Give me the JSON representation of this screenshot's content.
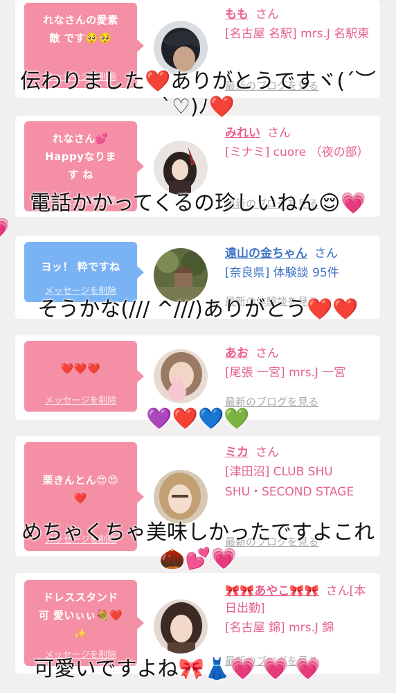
{
  "cards": [
    {
      "message": "れなさんの愛素敵 です🥺🥺",
      "delete_label": "メッセージを削除",
      "user": "もも",
      "san": "さん",
      "shop": "[名古屋 名駅] mrs.J 名駅東",
      "blog": "最新のブログを見る"
    },
    {
      "message": "れなさん💕 Happyなります ね",
      "delete_label": "メッセージを削除",
      "user": "みれい",
      "san": "さん",
      "shop": "[ミナミ] cuore （夜の部）",
      "blog": "最新のブログを見る"
    },
    {
      "message": "ヨッ！ 粋ですね",
      "delete_label": "メッセージを削除",
      "user": "遠山の金ちゃん",
      "san": "さん",
      "shop": "[奈良県] 体験談 95件",
      "blog": "最新の体験談を見る"
    },
    {
      "message": "❤️❤️❤️",
      "delete_label": "メッセージを削除",
      "user": "あお",
      "san": "さん",
      "shop": "[尾張 一宮] mrs.J 一宮",
      "blog": "最新のブログを見る"
    },
    {
      "message": "栗きんとん😍😍 ❤️",
      "delete_label": "メッセージを削除",
      "user": "ミカ",
      "san": "さん",
      "shop": "[津田沼] CLUB SHU SHU・SECOND STAGE",
      "blog": "最新のブログを見る"
    },
    {
      "message": "ドレススタンド可 愛いぃぃ💐❤️✨",
      "delete_label": "メッセージを削除",
      "user": "🎀🎀あやこ🎀🎀",
      "san": "さん[本日出勤]",
      "shop": "[名古屋 錦] mrs.J 錦",
      "blog": "最新のブログを見る"
    }
  ],
  "overlays": [
    "伝わりました❤️ありがとうですヾ(´︶",
    "`♡)ﾉ❤️",
    "電話かかってくるの珍しいねん😌💗",
    "💗",
    "そうかな(/// ^///)ありがとう❤️❤️",
    "💜❤️💙💚",
    "めちゃくちゃ美味しかったですよこれ",
    "🌰💕💗",
    "可愛いですよね🎀👗💗 💗 💗"
  ],
  "colors": {
    "pink_bubble": "#f48fa5",
    "blue_bubble": "#7ab3f4",
    "pink_text": "#e8608a",
    "blue_text": "#3d72c4",
    "background": "#f1eff0"
  }
}
